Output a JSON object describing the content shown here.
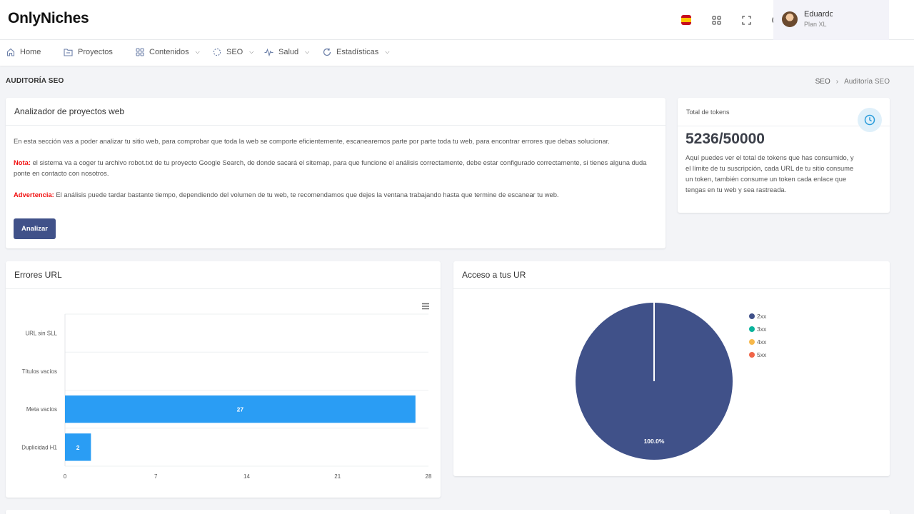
{
  "brand": "OnlyNiches",
  "topbar": {
    "user_name": "Eduardo",
    "user_plan": "Plan XL"
  },
  "nav": {
    "items": [
      {
        "label": "Home",
        "icon": "home-icon",
        "has_dropdown": false
      },
      {
        "label": "Proyectos",
        "icon": "folder-icon",
        "has_dropdown": false
      },
      {
        "label": "Contenidos",
        "icon": "grid-icon",
        "has_dropdown": true
      },
      {
        "label": "SEO",
        "icon": "loader-icon",
        "has_dropdown": true
      },
      {
        "label": "Salud",
        "icon": "pulse-icon",
        "has_dropdown": true
      },
      {
        "label": "Estadísticas",
        "icon": "refresh-icon",
        "has_dropdown": true
      }
    ]
  },
  "page": {
    "title": "AUDITORÍA SEO",
    "breadcrumb": [
      "SEO",
      "Auditoría SEO"
    ]
  },
  "analyzer": {
    "title": "Analizador de proyectos web",
    "intro": "En esta sección vas a poder analizar tu sitio web, para comprobar que toda la web se comporte eficientemente, escanearemos parte por parte toda tu web, para encontrar errores que debas solucionar.",
    "note_label": "Nota:",
    "note_text": " el sistema va a coger tu archivo robot.txt de tu proyecto Google Search, de donde sacará el sitemap, para que funcione el análisis correctamente, debe estar configurado correctamente, si tienes alguna duda ponte en contacto con nosotros.",
    "warning_label": "Advertencia:",
    "warning_text": " El análisis puede tardar bastante tiempo, dependiendo del volumen de tu web, te recomendamos que dejes la ventana trabajando hasta que termine de escanear tu web.",
    "button": "Analizar"
  },
  "tokens": {
    "label": "Total de tokens",
    "value": "5236/50000",
    "description": "Aquí puedes ver el total de tokens que has consumido, y el límite de tu suscripción, cada URL de tu sitio consume un token, también consume un token cada enlace que tengas en tu web y sea rastreada."
  },
  "errors_card": {
    "title": "Errores URL"
  },
  "access_card": {
    "title": "Acceso a tus UR"
  },
  "chart_data": [
    {
      "type": "bar",
      "orientation": "horizontal",
      "categories": [
        "URL sin SLL",
        "Títulos vacíos",
        "Meta vacíos",
        "Duplicidad H1"
      ],
      "values": [
        0,
        0,
        27,
        2
      ],
      "xticks": [
        0,
        7,
        14,
        21,
        28
      ],
      "xlim": [
        0,
        28
      ],
      "color": "#2a9df4",
      "data_labels": true,
      "grid": true
    },
    {
      "type": "pie",
      "labels": [
        "2xx",
        "3xx",
        "4xx",
        "5xx"
      ],
      "values": [
        100,
        0,
        0,
        0
      ],
      "colors": [
        "#405189",
        "#0ab39c",
        "#f7b84b",
        "#f06548"
      ],
      "slice_label": "100.0%",
      "legend": "top-right"
    }
  ]
}
